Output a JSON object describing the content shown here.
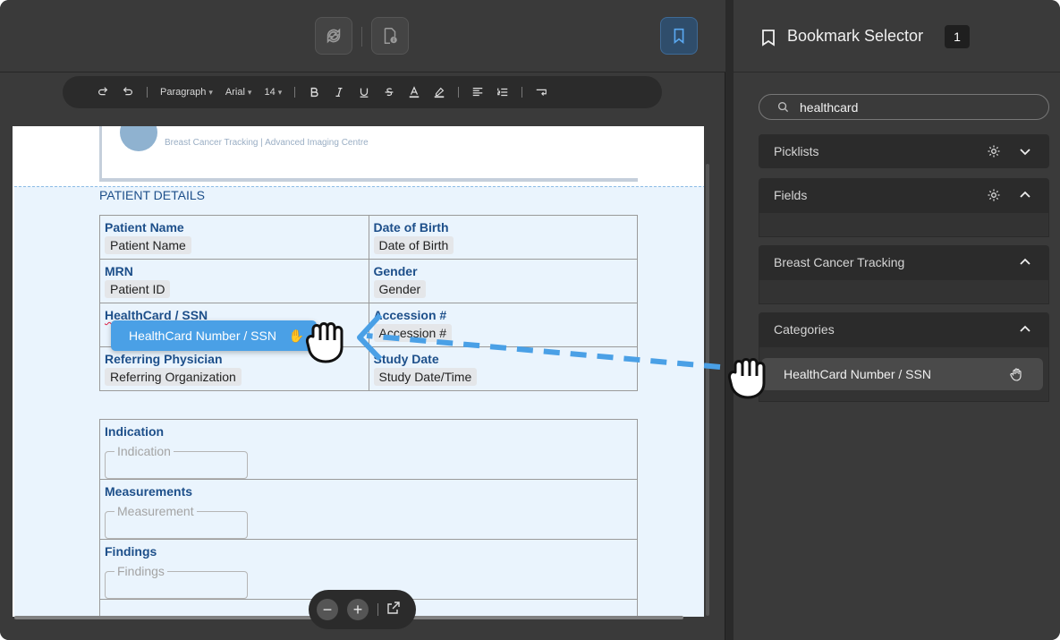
{
  "toolbar": {
    "paragraph_label": "Paragraph",
    "font_label": "Arial",
    "size_label": "14"
  },
  "document": {
    "logo_subtitle": "Breast Cancer Tracking | Advanced Imaging Centre",
    "section_title": "PATIENT DETAILS",
    "rows": [
      {
        "left_label": "Patient Name",
        "left_value": "Patient Name",
        "right_label": "Date of Birth",
        "right_value": "Date of Birth"
      },
      {
        "left_label": "MRN",
        "left_value": "Patient ID",
        "right_label": "Gender",
        "right_value": "Gender"
      },
      {
        "left_label": "HealthCard / SSN",
        "left_value": "",
        "right_label": "Accession #",
        "right_value": "Accession #"
      },
      {
        "left_label": "Referring Physician",
        "left_value": "Referring Organization",
        "right_label": "Study Date",
        "right_value": "Study Date/Time"
      }
    ],
    "exam": [
      {
        "label": "Indication",
        "placeholder": "Indication"
      },
      {
        "label": "Measurements",
        "placeholder": "Measurement"
      },
      {
        "label": "Findings",
        "placeholder": "Findings"
      }
    ]
  },
  "drag": {
    "ghost_label": "HealthCard Number / SSN"
  },
  "panel": {
    "title": "Bookmark Selector",
    "count": "1",
    "search_value": "healthcard",
    "sections": {
      "picklists": "Picklists",
      "fields": "Fields",
      "breast_cancer": "Breast Cancer Tracking",
      "categories": "Categories"
    },
    "category_item": "HealthCard Number / SSN"
  },
  "colors": {
    "accent": "#4aa0e6",
    "doc_label": "#1d4f8a"
  }
}
